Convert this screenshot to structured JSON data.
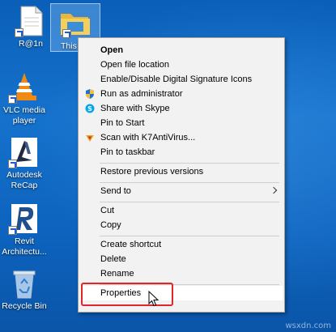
{
  "desktop": {
    "icons": [
      {
        "label": "R@1n",
        "icon": "document-file-icon"
      },
      {
        "label": "This PC",
        "icon": "folder-icon"
      },
      {
        "label": "VLC media player",
        "icon": "vlc-cone-icon"
      },
      {
        "label": "Autodesk ReCap",
        "icon": "autodesk-recap-icon"
      },
      {
        "label": "Revit Architectu...",
        "icon": "revit-icon"
      },
      {
        "label": "Recycle Bin",
        "icon": "recycle-bin-icon"
      }
    ],
    "selected_label_partial": "This"
  },
  "context_menu": {
    "items": {
      "open": "Open",
      "open_location": "Open file location",
      "digital_signature": "Enable/Disable Digital Signature Icons",
      "run_admin": "Run as administrator",
      "share_skype": "Share with Skype",
      "pin_start": "Pin to Start",
      "scan": "Scan with K7AntiVirus...",
      "pin_taskbar": "Pin to taskbar",
      "restore": "Restore previous versions",
      "send_to": "Send to",
      "cut": "Cut",
      "copy": "Copy",
      "create_shortcut": "Create shortcut",
      "delete": "Delete",
      "rename": "Rename",
      "properties": "Properties"
    },
    "highlighted_item": "Properties"
  },
  "watermark": "wsxdn.com",
  "colors": {
    "desktop_bg": "#0d63be",
    "menu_bg": "#f2f2f2",
    "highlight_border": "#e0262b"
  }
}
